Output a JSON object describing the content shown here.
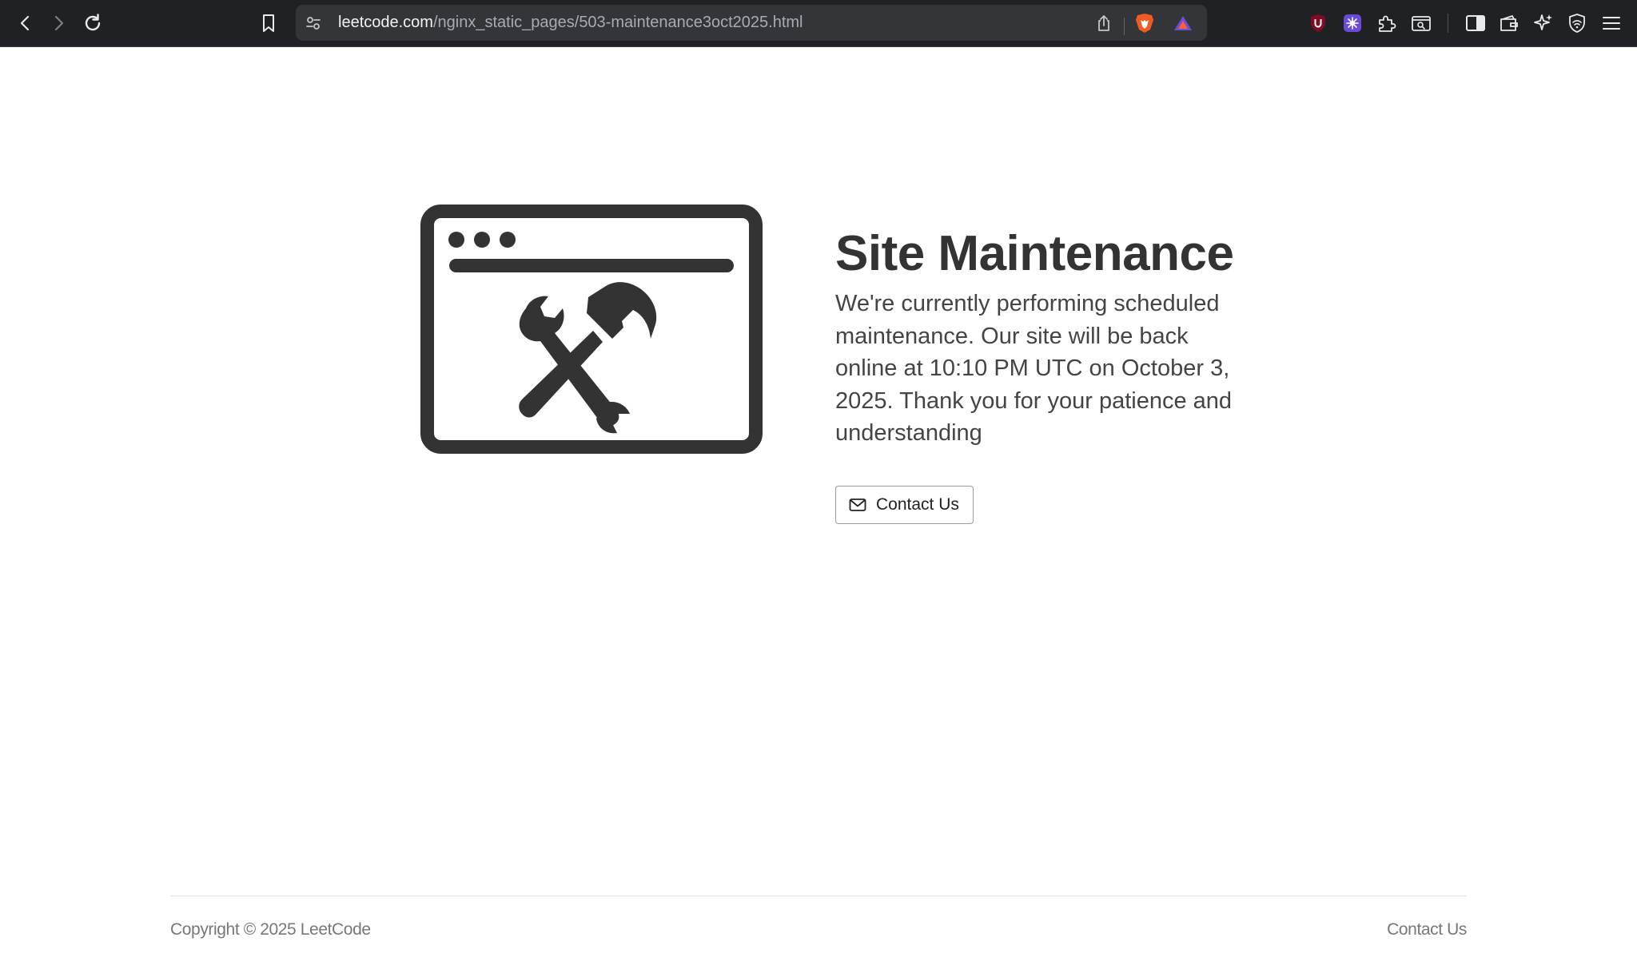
{
  "browser": {
    "url_host": "leetcode.com",
    "url_path": "/nginx_static_pages/503-maintenance3oct2025.html",
    "icons": [
      "back-icon",
      "forward-icon",
      "reload-icon",
      "bookmark-icon",
      "site-settings-icon",
      "share-icon",
      "brave-shields-icon",
      "brave-rewards-icon",
      "ublock-icon",
      "extension-icon",
      "extensions-puzzle-icon",
      "find-icon",
      "sidebar-icon",
      "wallet-icon",
      "leo-ai-icon",
      "vpn-icon",
      "menu-icon"
    ]
  },
  "main": {
    "title": "Site Maintenance",
    "message": "We're currently performing scheduled maintenance. Our site will be back online at 10:10 PM UTC on October 3, 2025. Thank you for your patience and understanding",
    "contact_button_label": "Contact Us",
    "illustration_icon": "browser-window-tools-icon"
  },
  "footer": {
    "copyright": "Copyright © 2025 LeetCode",
    "contact_link": "Contact Us"
  },
  "colors": {
    "chrome_bg": "#202124",
    "urlbar_bg": "#343539",
    "text_dark": "#333333",
    "text_muted": "#777777"
  }
}
